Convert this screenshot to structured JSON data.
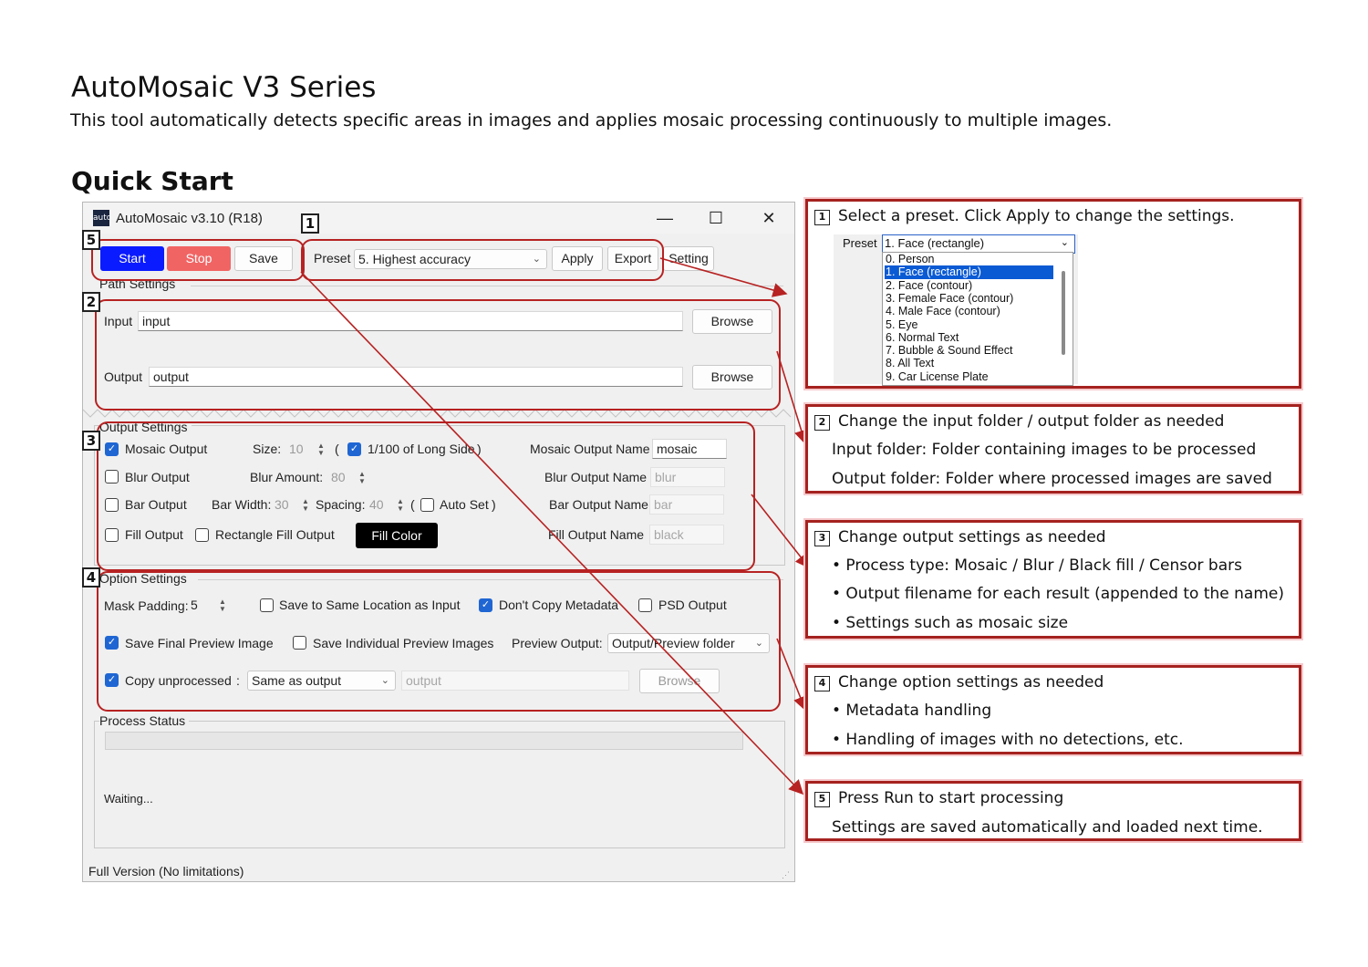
{
  "doc": {
    "title": "AutoMosaic V3 Series",
    "subtitle": "This tool automatically detects specific areas in images and applies mosaic processing continuously to multiple images.",
    "quick_start": "Quick Start"
  },
  "window": {
    "icon_text": "auto",
    "title": "AutoMosaic v3.10 (R18)",
    "minimize": "—",
    "maximize": "☐",
    "close": "✕",
    "footer": "Full Version (No limitations)"
  },
  "toolbar": {
    "start": "Start",
    "stop": "Stop",
    "save": "Save",
    "preset_label": "Preset",
    "preset_value": "5. Highest accuracy",
    "apply": "Apply",
    "export": "Export",
    "setting": "Setting"
  },
  "path_settings": {
    "title": "Path Settings",
    "input_label": "Input",
    "input_value": "input",
    "output_label": "Output",
    "output_value": "output",
    "browse": "Browse"
  },
  "output_settings": {
    "title": "Output Settings",
    "mosaic_output": "Mosaic Output",
    "mosaic_checked": true,
    "size_label": "Size:",
    "size_value": "10",
    "open_paren": "(",
    "long_side": "1/100 of Long Side",
    "close_paren": ")",
    "long_side_checked": true,
    "mosaic_name_label": "Mosaic Output Name",
    "mosaic_name": "mosaic",
    "blur_output": "Blur Output",
    "blur_amount_label": "Blur Amount:",
    "blur_amount": "80",
    "blur_name_label": "Blur Output Name",
    "blur_name": "blur",
    "bar_output": "Bar Output",
    "bar_width_label": "Bar Width:",
    "bar_width": "30",
    "spacing_label": "Spacing:",
    "spacing": "40",
    "auto_set": "Auto Set",
    "bar_name_label": "Bar Output Name",
    "bar_name": "bar",
    "fill_output": "Fill Output",
    "rect_fill_output": "Rectangle Fill Output",
    "fill_color": "Fill Color",
    "fill_name_label": "Fill Output Name",
    "fill_name": "black"
  },
  "option_settings": {
    "title": "Option Settings",
    "mask_padding_label": "Mask Padding:",
    "mask_padding": "5",
    "save_same_location": "Save to Same Location as Input",
    "dont_copy_metadata": "Don't Copy Metadata",
    "psd_output": "PSD Output",
    "save_final_preview": "Save Final Preview Image",
    "save_individual_preview": "Save Individual Preview Images",
    "preview_output_label": "Preview Output:",
    "preview_output_value": "Output/Preview folder",
    "copy_unprocessed": "Copy unprocessed",
    "colon": ":",
    "copy_mode": "Same as output",
    "copy_path": "output",
    "browse": "Browse"
  },
  "process_status": {
    "title": "Process Status",
    "status": "Waiting..."
  },
  "markers": [
    "1",
    "2",
    "3",
    "4",
    "5"
  ],
  "notes": [
    {
      "num": "1",
      "lines": [
        "Select a preset. Click Apply to change the settings."
      ]
    },
    {
      "num": "2",
      "lines": [
        "Change the input folder / output folder as needed",
        "Input folder: Folder containing images to be processed",
        "Output folder: Folder where processed images are saved"
      ]
    },
    {
      "num": "3",
      "lines": [
        "Change output settings as needed",
        "• Process type: Mosaic / Blur / Black fill / Censor bars",
        "• Output filename for each result (appended to the name)",
        "• Settings such as mosaic size"
      ]
    },
    {
      "num": "4",
      "lines": [
        "Change option settings as needed",
        "• Metadata handling",
        "• Handling of images with no detections, etc."
      ]
    },
    {
      "num": "5",
      "lines": [
        "Press Run to start processing",
        "Settings are saved automatically and loaded next time."
      ]
    }
  ],
  "preset_dropdown": {
    "label": "Preset",
    "selected": "1. Face (rectangle)",
    "options": [
      "0. Person",
      "1. Face (rectangle)",
      "2. Face (contour)",
      "3. Female Face (contour)",
      "4. Male Face (contour)",
      "5. Eye",
      "6. Normal Text",
      "7. Bubble & Sound Effect",
      "8. All Text",
      "9. Car License Plate"
    ]
  },
  "colors": {
    "annotation_red": "#b72222",
    "start_blue": "#0a1bff",
    "stop_red": "#f16464",
    "checkbox_blue": "#1f66d3",
    "selection_blue": "#0a5ad4"
  }
}
